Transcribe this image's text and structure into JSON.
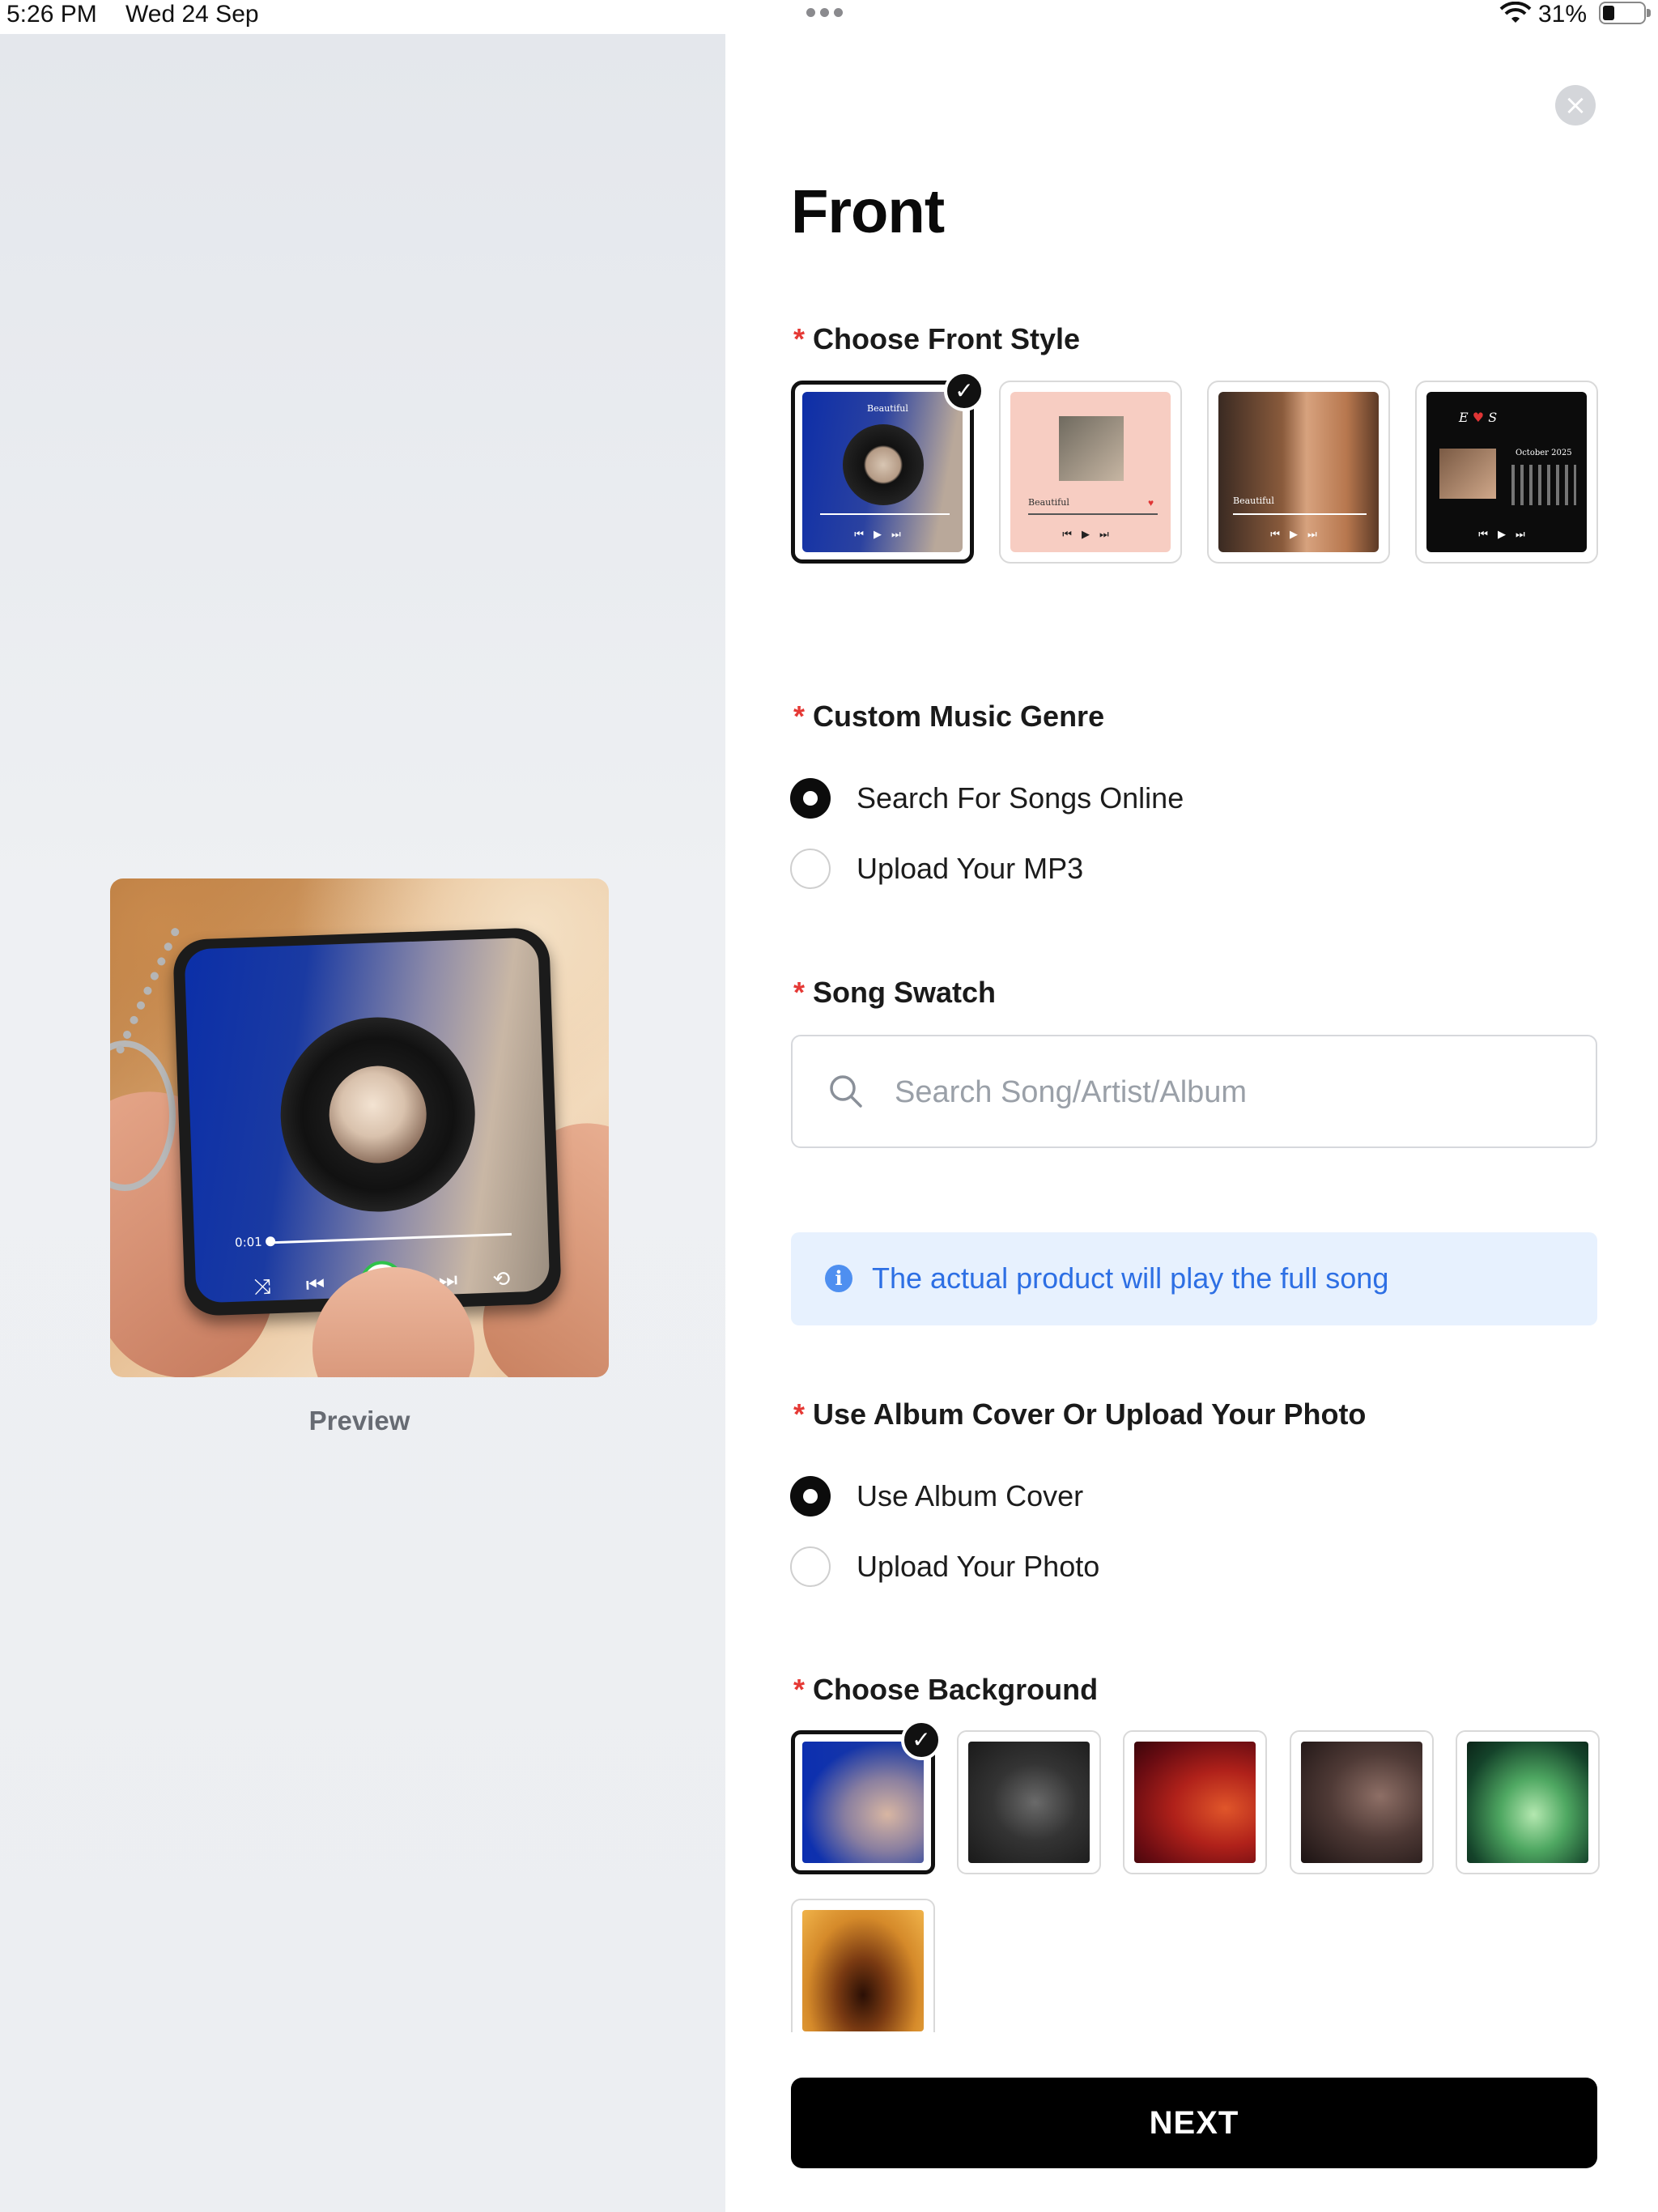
{
  "status_bar": {
    "time": "5:26 PM",
    "date": "Wed 24 Sep",
    "battery_percent": "31%",
    "wifi_icon": "wifi-icon",
    "battery_icon": "battery-icon"
  },
  "preview": {
    "label": "Preview",
    "player_time": "0:01",
    "player_center_glyph": "b"
  },
  "form": {
    "title": "Front",
    "close_glyph": "×",
    "required_mark": "*",
    "front_style": {
      "label": "Choose Front Style",
      "selected_index": 0,
      "options": [
        {
          "name": "vinyl-style",
          "caption": "Beautiful"
        },
        {
          "name": "pink-photo-style",
          "caption": "Beautiful"
        },
        {
          "name": "full-photo-style",
          "caption": "Beautiful"
        },
        {
          "name": "calendar-style",
          "caption": "October 2025"
        }
      ]
    },
    "music_genre": {
      "label": "Custom Music Genre",
      "options": [
        "Search For Songs Online",
        "Upload Your MP3"
      ],
      "selected_index": 0
    },
    "song_swatch": {
      "label": "Song Swatch",
      "placeholder": "Search Song/Artist/Album",
      "value": ""
    },
    "info_banner": {
      "icon_glyph": "i",
      "text": "The actual product will play the full song"
    },
    "album_cover": {
      "label": "Use Album Cover Or Upload Your Photo",
      "options": [
        "Use Album Cover",
        "Upload Your Photo"
      ],
      "selected_index": 0
    },
    "background": {
      "label": "Choose Background",
      "selected_index": 0,
      "swatches": [
        "blue-blur",
        "dark-gray-blur",
        "red-blur",
        "brown-blur",
        "green-blur",
        "amber-blur"
      ]
    },
    "next_label": "NEXT"
  },
  "colors": {
    "accent": "#000000",
    "required": "#e53935",
    "info_bg": "#e7f1fe",
    "info_text": "#2d6fe4",
    "play_ring": "#2fc24a"
  }
}
